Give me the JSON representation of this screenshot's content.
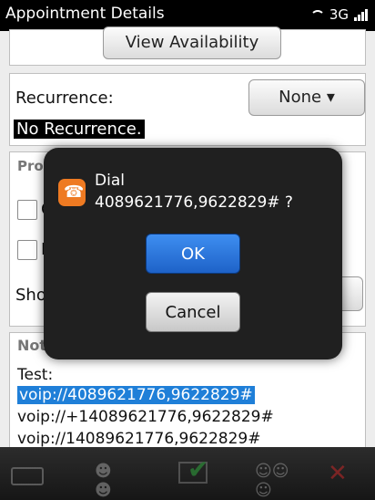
{
  "status_bar": {
    "title": "Appointment Details",
    "network": "3G"
  },
  "form": {
    "view_availability_label": "View Availability",
    "recurrence_label": "Recurrence:",
    "recurrence_value": "None",
    "recurrence_summary": "No Recurrence.",
    "section_partial": "Pro",
    "checkbox1_partial": "C",
    "checkbox2_partial": "N",
    "show_partial": "Sho",
    "notes_header_partial": "Not"
  },
  "notes": {
    "lines": [
      "Test:",
      "voip://4089621776,9622829#",
      "voip://+14089621776,9622829#",
      "voip://14089621776,9622829#"
    ]
  },
  "dialog": {
    "line1": "Dial",
    "line2": "4089621776,9622829# ?",
    "ok_label": "OK",
    "cancel_label": "Cancel"
  },
  "toolbar": {
    "icons": [
      "keyboard-icon",
      "contacts-icon",
      "save-icon",
      "invite-icon",
      "close-icon"
    ]
  },
  "colors": {
    "selection": "#1f7fd8",
    "ok_button": "#2a70d8",
    "dial_icon": "#ee7a22",
    "save_check": "#2fa63d",
    "close_x": "#c62828"
  }
}
